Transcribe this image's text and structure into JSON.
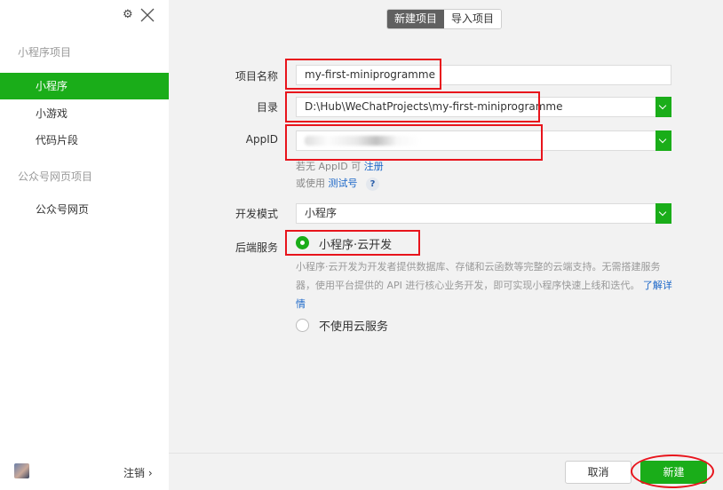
{
  "sidebar": {
    "section_miniprogram": "小程序项目",
    "items_miniprogram": [
      {
        "label": "小程序",
        "active": true
      },
      {
        "label": "小游戏",
        "active": false
      },
      {
        "label": "代码片段",
        "active": false
      }
    ],
    "section_official": "公众号网页项目",
    "items_official": [
      {
        "label": "公众号网页",
        "active": false
      }
    ],
    "logout_label": "注销 ›"
  },
  "tabs": [
    {
      "label": "新建项目",
      "active": true
    },
    {
      "label": "导入项目",
      "active": false
    }
  ],
  "form": {
    "name_label": "项目名称",
    "name_value": "my-first-miniprogramme",
    "dir_label": "目录",
    "dir_value": "D:\\Hub\\WeChatProjects\\my-first-miniprogramme",
    "appid_label": "AppID",
    "appid_hint_prefix": "若无 AppID 可",
    "appid_hint_link": "注册",
    "appid_hint2_prefix": "或使用",
    "appid_hint2_link": "测试号",
    "help_icon": "?",
    "mode_label": "开发模式",
    "mode_value": "小程序",
    "backend_label": "后端服务",
    "backend_option_cloud": "小程序·云开发",
    "backend_desc": "小程序·云开发为开发者提供数据库、存储和云函数等完整的云端支持。无需搭建服务器，使用平台提供的 API 进行核心业务开发，即可实现小程序快速上线和迭代。",
    "backend_desc_link": "了解详情",
    "backend_option_none": "不使用云服务"
  },
  "footer": {
    "cancel_label": "取消",
    "create_label": "新建"
  },
  "colors": {
    "accent": "#1aad19",
    "highlight": "#e8141c",
    "link": "#1a66c8"
  }
}
